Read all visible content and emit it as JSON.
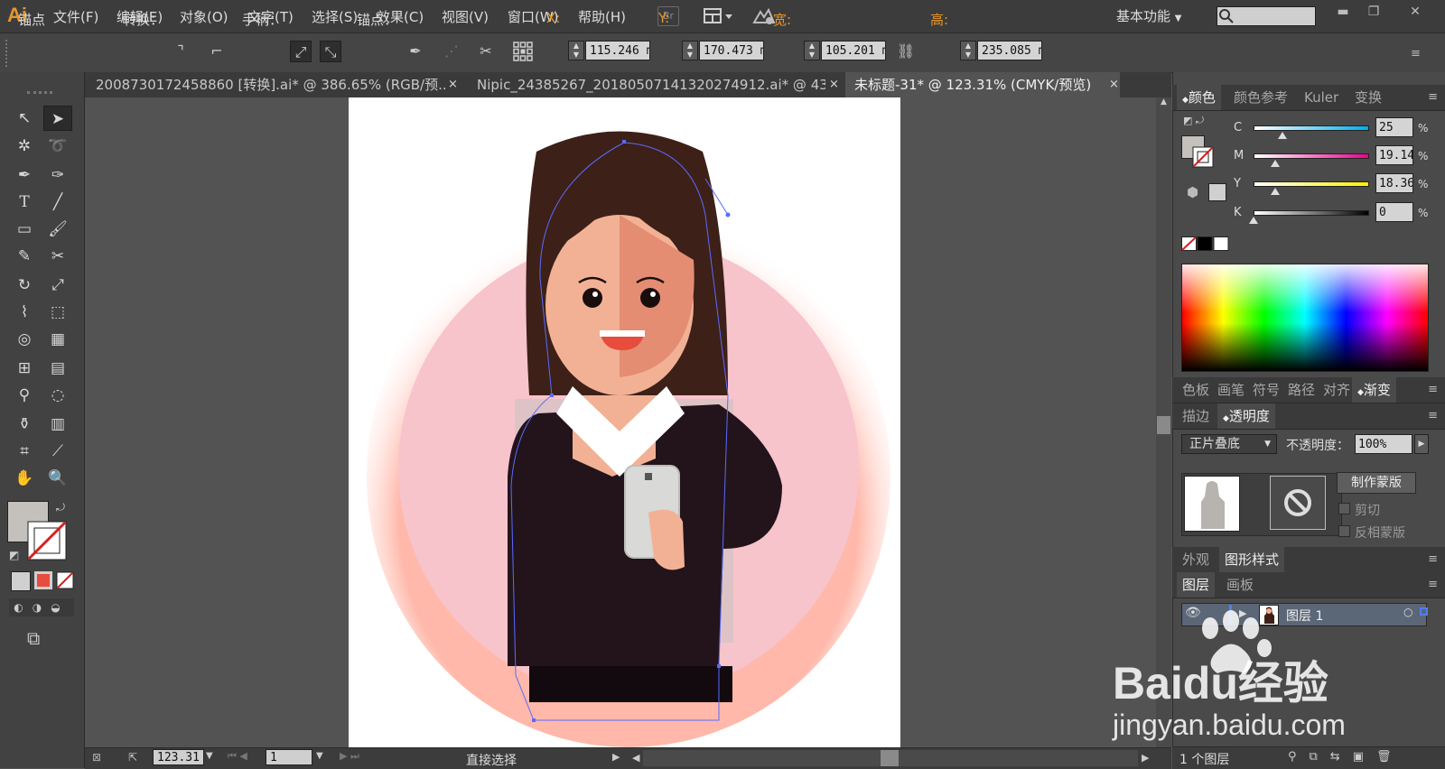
{
  "app": {
    "logo": "Ai",
    "workspace": "基本功能"
  },
  "menu": [
    "文件(F)",
    "编辑(E)",
    "对象(O)",
    "文字(T)",
    "选择(S)",
    "效果(C)",
    "视图(V)",
    "窗口(W)",
    "帮助(H)"
  ],
  "bridge_label": "Br",
  "window_controls": {
    "minimize": "▬",
    "restore": "❐",
    "close": "✕"
  },
  "control": {
    "mode": "锚点",
    "convert_label": "转换：",
    "handle_label": "手柄：",
    "anchor_label": "锚点：",
    "x_label": "X:",
    "x_value": "115.246 m",
    "y_label": "Y:",
    "y_value": "170.473 m",
    "w_label": "宽:",
    "w_value": "105.201 m",
    "h_label": "高:",
    "h_value": "235.085 m"
  },
  "tabs": [
    {
      "title": "2008730172458860 [转换].ai* @ 386.65% (RGB/预...",
      "close": "×"
    },
    {
      "title": "Nipic_24385267_20180507141320274912.ai* @ 43...",
      "close": "×"
    },
    {
      "title": "未标题-31* @ 123.31% (CMYK/预览)",
      "close": "×",
      "active": true
    }
  ],
  "status": {
    "zoom": "123.31",
    "artboard": "1",
    "tool": "直接选择"
  },
  "color_panel": {
    "tabs": [
      "颜色",
      "颜色参考",
      "Kuler",
      "变换"
    ],
    "channels": [
      {
        "label": "C",
        "value": "25",
        "level_pct": 25
      },
      {
        "label": "M",
        "value": "19.14",
        "level_pct": 19.14
      },
      {
        "label": "Y",
        "value": "18.36",
        "level_pct": 18.36
      },
      {
        "label": "K",
        "value": "0",
        "level_pct": 0
      }
    ],
    "percent": "%",
    "fill_color": "#c4c1bd"
  },
  "panel2": {
    "tabs": [
      "色板",
      "画笔",
      "符号",
      "路径",
      "对齐",
      "渐变"
    ]
  },
  "transparency": {
    "tabs": [
      "描边",
      "透明度"
    ],
    "blend_mode": "正片叠底",
    "opacity_label": "不透明度：",
    "opacity_value": "100%",
    "make_mask": "制作蒙版",
    "clip": "剪切",
    "invert_mask": "反相蒙版"
  },
  "appearance": {
    "tabs": [
      "外观",
      "图形样式"
    ]
  },
  "layers": {
    "tabs": [
      "图层",
      "画板"
    ],
    "layer_name": "图层 1",
    "count": "1 个图层"
  },
  "watermark": {
    "brand": "Baidu经验",
    "url": "jingyan.baidu.com"
  },
  "illustration_colors": {
    "circle": "#f7c4cc",
    "hair": "#3d2018",
    "skin": "#f2b195",
    "skin_shade": "#e48d72",
    "suit": "#23141c",
    "collar": "#ffffff",
    "phone": "#d9d9d7",
    "mouth": "#e74c3c",
    "path": "#5a6bff"
  }
}
